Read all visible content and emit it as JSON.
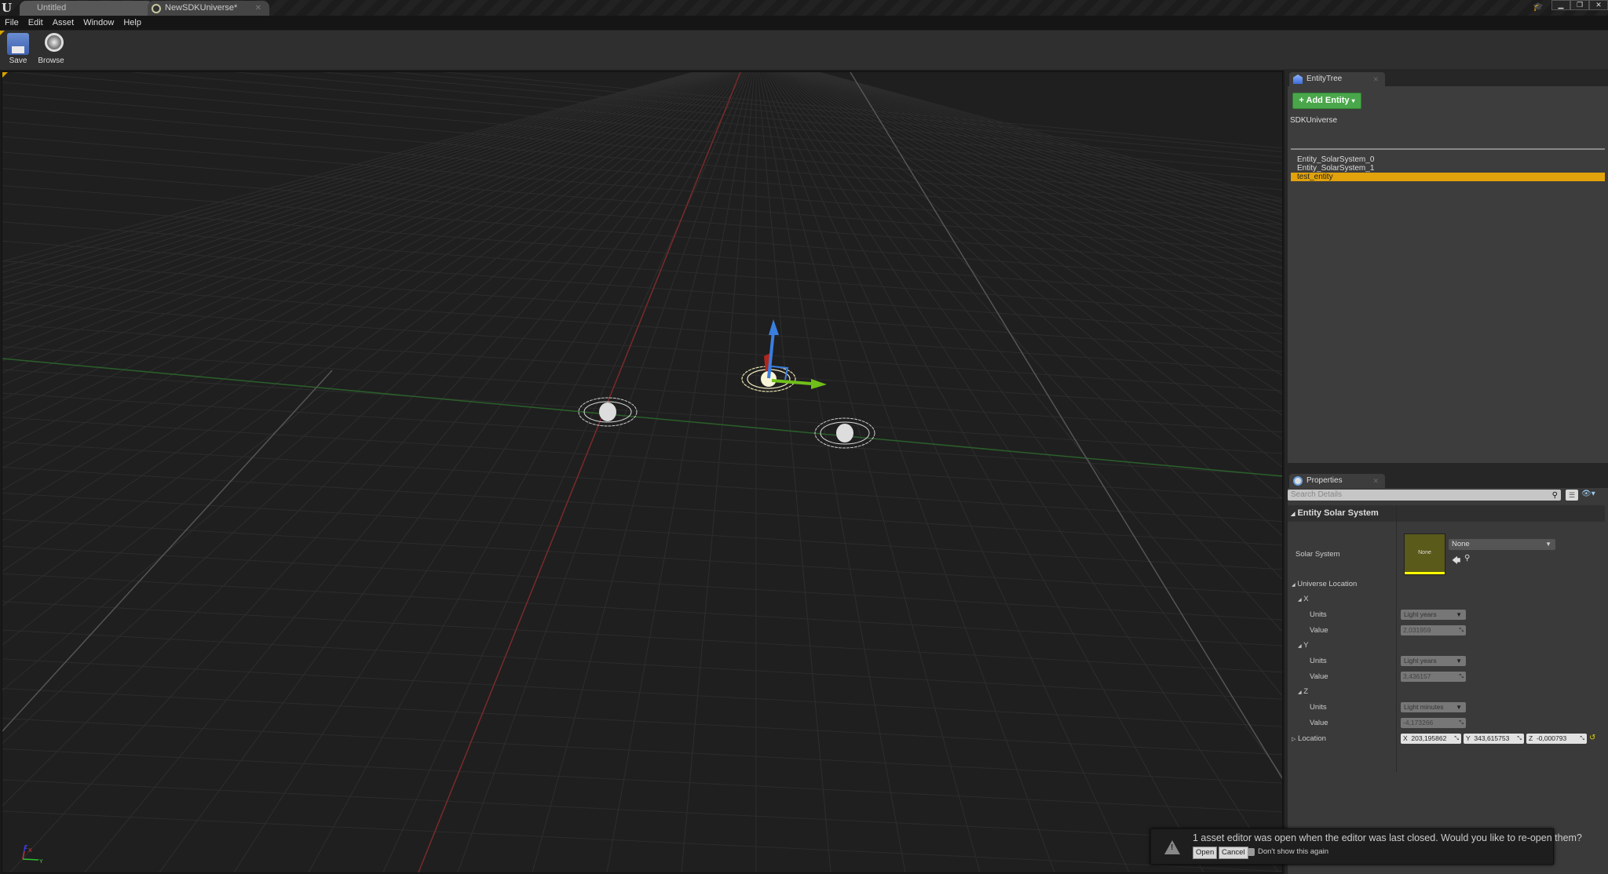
{
  "titlebar": {
    "tabs": [
      {
        "label": "Untitled",
        "active": false
      },
      {
        "label": "NewSDKUniverse*",
        "active": true
      }
    ],
    "window_controls": [
      "minimize",
      "restore",
      "close"
    ]
  },
  "menu": {
    "items": [
      "File",
      "Edit",
      "Asset",
      "Window",
      "Help"
    ]
  },
  "toolbar": {
    "save_label": "Save",
    "browse_label": "Browse"
  },
  "viewport": {
    "axis_labels": {
      "z": "Z",
      "x": "X",
      "y": "Y"
    },
    "colors": {
      "x_axis": "#8a2a2a",
      "y_axis": "#2f6e2f",
      "gizmo_z": "#3a7ee0",
      "gizmo_y": "#6fbf1a",
      "gizmo_x": "#b0261c"
    }
  },
  "entity_tree": {
    "tab_label": "EntityTree",
    "add_entity_label": "+ Add Entity",
    "root_label": "SDKUniverse",
    "items": [
      {
        "label": "Entity_SolarSystem_0",
        "selected": false
      },
      {
        "label": "Entity_SolarSystem_1",
        "selected": false
      },
      {
        "label": "test_entity",
        "selected": true
      }
    ],
    "selection_color": "#e1a20c"
  },
  "properties": {
    "tab_label": "Properties",
    "search_placeholder": "Search Details",
    "section_title": "Entity Solar System",
    "solar_system": {
      "label": "Solar System",
      "thumbnail_text": "None",
      "selected_value": "None"
    },
    "universe_location": {
      "label": "Universe Location",
      "axes": [
        {
          "name": "X",
          "units_label": "Units",
          "units": "Light years",
          "value_label": "Value",
          "value": "2,031959"
        },
        {
          "name": "Y",
          "units_label": "Units",
          "units": "Light years",
          "value_label": "Value",
          "value": "3,436157"
        },
        {
          "name": "Z",
          "units_label": "Units",
          "units": "Light minutes",
          "value_label": "Value",
          "value": "-4,173266"
        }
      ]
    },
    "location": {
      "label": "Location",
      "x_label": "X",
      "x": "203,195862",
      "y_label": "Y",
      "y": "343,615753",
      "z_label": "Z",
      "z": "-0,000793"
    }
  },
  "notification": {
    "message": "1 asset editor was open when the editor was last closed. Would you like to re-open them?",
    "open_label": "Open",
    "cancel_label": "Cancel",
    "dont_show_label": "Don't show this again",
    "dont_show_checked": false
  }
}
